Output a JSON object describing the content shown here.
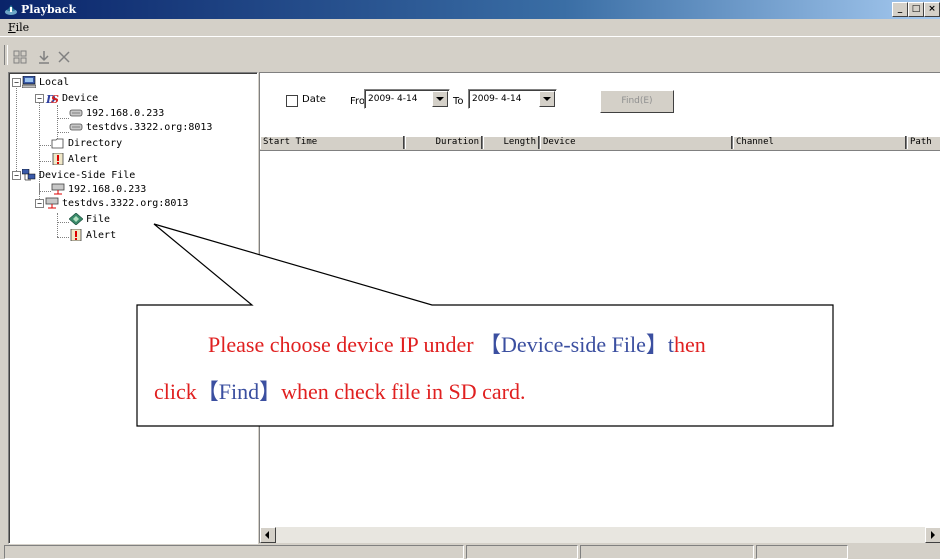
{
  "window": {
    "title": "Playback"
  },
  "menu": {
    "file_hotkey": "F",
    "file_rest": "ile"
  },
  "tree": {
    "local": "Local",
    "device": "Device",
    "local_ip1": "192.168.0.233",
    "local_ip2": "testdvs.3322.org:8013",
    "directory": "Directory",
    "local_alert": "Alert",
    "device_side": "Device-Side File",
    "ds_ip1": "192.168.0.233",
    "ds_ip2": "testdvs.3322.org:8013",
    "ds_file": "File",
    "ds_alert": "Alert"
  },
  "filter": {
    "date_label": "Date",
    "from_label": "Fro",
    "from_value": "2009- 4-14",
    "to_label": "To",
    "to_value": "2009- 4-14",
    "find_label": "Find(E)"
  },
  "columns": [
    "Start Time",
    "Duration",
    "Length",
    "Device",
    "Channel",
    "Path"
  ],
  "callout": {
    "line1_red": "Please choose device IP under ",
    "line1_blue": "【Device-side File】",
    "line1_red_t": "t",
    "line1_red_end": "hen",
    "line2_red_a": "click",
    "line2_blue": "【Find】",
    "line2_red_b": "when check file in SD card."
  },
  "colors": {
    "title_start": "#0a246a",
    "title_end": "#a6caf0",
    "callout_red": "#e02020",
    "callout_blue": "#3b4fa0"
  }
}
